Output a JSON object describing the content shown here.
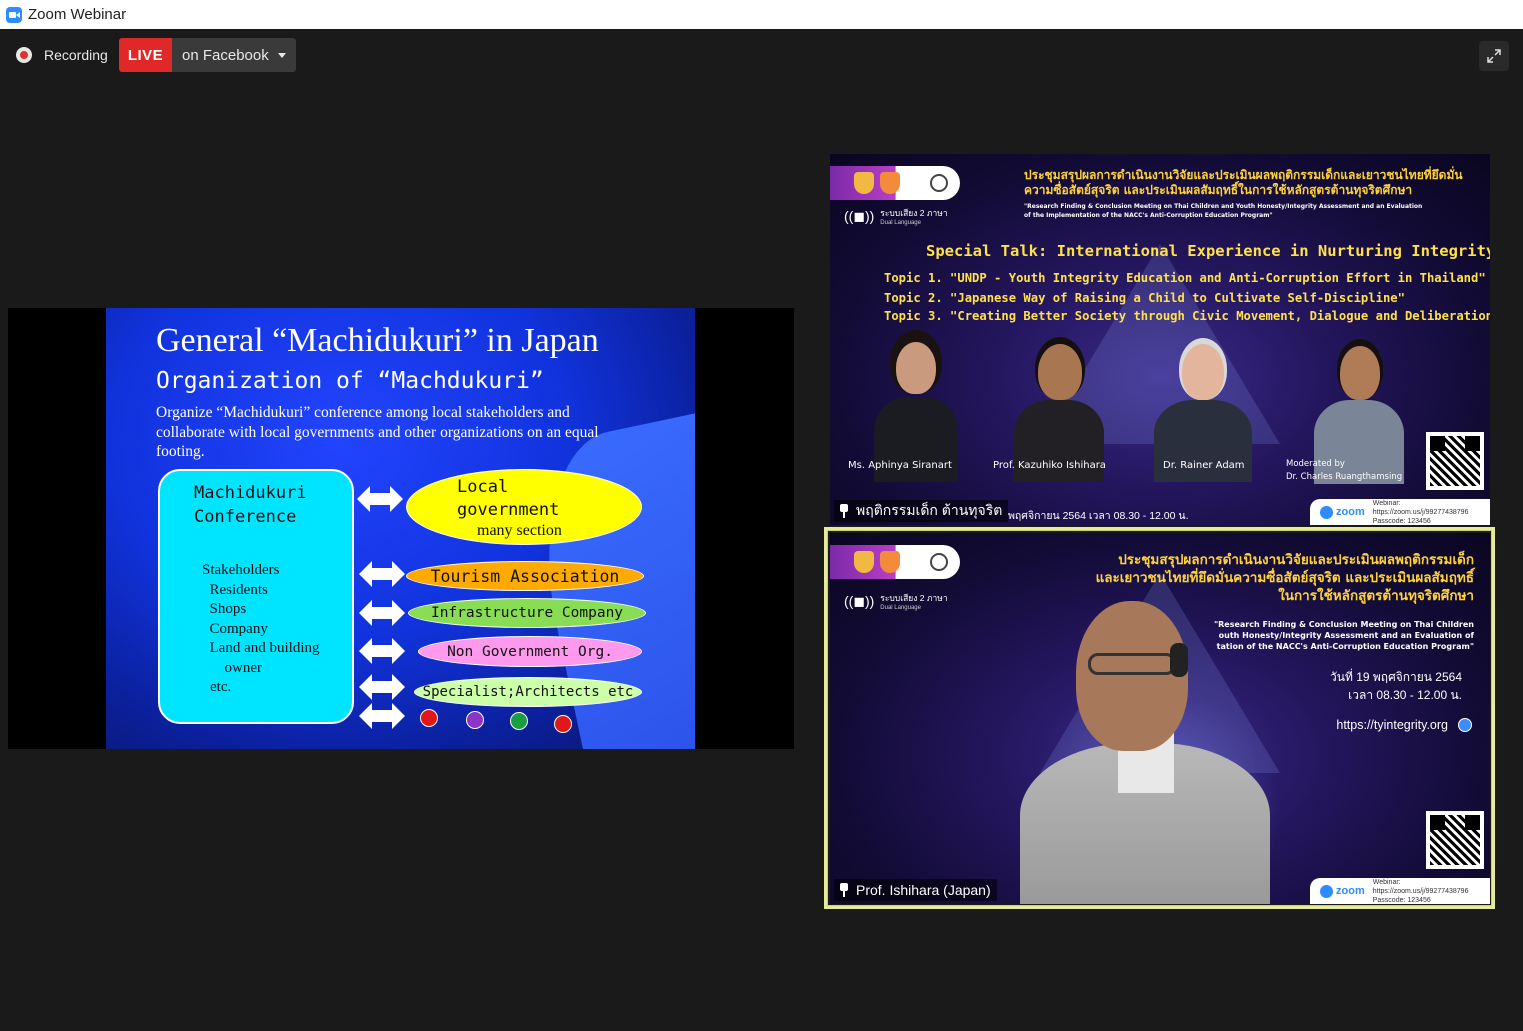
{
  "window": {
    "title": "Zoom Webinar"
  },
  "toolbar": {
    "recording_label": "Recording",
    "live_badge": "LIVE",
    "live_target": "on Facebook"
  },
  "slide": {
    "title": "General “Machidukuri” in Japan",
    "subtitle": "Organization of  “Machdukuri”",
    "body": "Organize “Machidukuri” conference among local stakeholders and collaborate with local governments and other organizations on an equal footing.",
    "conference_title": "Machidukuri\nConference",
    "stakeholders": [
      "Stakeholders",
      "  Residents",
      "  Shops",
      "  Company",
      "  Land and building",
      "      owner",
      "etc."
    ],
    "local_gov_line1": "Local",
    "local_gov_line2": "government",
    "local_gov_line3": "many section",
    "orgs": [
      "Tourism Association",
      "Infrastructure Company",
      "Non Government Org.",
      "Specialist;Architects etc"
    ],
    "colors": {
      "background": "#1133dd",
      "conference_box": "#00e5ff",
      "local_gov": "#ffff00",
      "tourism": "#ffaa00",
      "infrastructure": "#88dd55",
      "ngo": "#ff99ee",
      "specialist": "#ccffaa"
    },
    "dot_colors": [
      "#e01818",
      "#8a35c8",
      "#18a040",
      "#e01818"
    ]
  },
  "tile_top": {
    "thai_title_line1": "ประชุมสรุปผลการดำเนินงานวิจัยและประเมินผลพฤติกรรมเด็กและเยาวชนไทยที่ยึดมั่น",
    "thai_title_line2": "ความซื่อสัตย์สุจริต และประเมินผลสัมฤทธิ์ในการใช้หลักสูตรต้านทุจริตศึกษา",
    "en_title_line1": "\"Research Finding & Conclusion Meeting on Thai Children and Youth Honesty/Integrity Assessment and an Evaluation",
    "en_title_line2": "of the Implementation of the NACC's Anti-Corruption Education Program\"",
    "dual_language": "ระบบเสียง 2 ภาษา",
    "dual_language_en": "Dual Language",
    "special_talk": "Special Talk: International Experience in Nurturing Integrity",
    "topics": [
      "Topic 1. \"UNDP - Youth Integrity Education and Anti-Corruption Effort in Thailand\"",
      "Topic 2. \"Japanese Way of Raising a Child to Cultivate Self-Discipline\"",
      "Topic 3. \"Creating Better Society through Civic Movement, Dialogue and Deliberation\""
    ],
    "speakers": [
      "Ms. Aphinya Siranart",
      "Prof. Kazuhiko Ishihara",
      "Dr. Rainer Adam"
    ],
    "moderator_label": "Moderated by",
    "moderator_name": "Dr. Charles Ruangthamsing",
    "bottom_date": "พฤศจิกายน 2564 เวลา 08.30 - 12.00 น.",
    "zoom_label": "zoom",
    "webinar_label": "Webinar: https://zoom.us/j/99277438796",
    "passcode_label": "Passcode: 123456",
    "participant_name": "พฤติกรรมเด็ก ต้านทุจริต"
  },
  "tile_bottom": {
    "thai_title_line1": "ประชุมสรุปผลการดำเนินงานวิจัยและประเมินผลพฤติกรรมเด็ก",
    "thai_title_line2": "และเยาวชนไทยที่ยึดมั่นความซื่อสัตย์สุจริต และประเมินผลสัมฤทธิ์",
    "thai_title_line3": "ในการใช้หลักสูตรต้านทุจริตศึกษา",
    "en_line1": "\"Research Finding & Conclusion Meeting on Thai Children",
    "en_line2": "outh Honesty/Integrity Assessment and an Evaluation of",
    "en_line3": "tation of the NACC's Anti-Corruption Education Program\"",
    "date": "วันที่ 19 พฤศจิกายน 2564",
    "time": "เวลา 08.30 - 12.00 น.",
    "url": "https://tyintegrity.org",
    "dual_language": "ระบบเสียง 2 ภาษา",
    "dual_language_en": "Dual Language",
    "zoom_label": "zoom",
    "webinar_label": "Webinar: https://zoom.us/j/99277438796",
    "passcode_label": "Passcode: 123456",
    "participant_name": "Prof. Ishihara (Japan)"
  }
}
